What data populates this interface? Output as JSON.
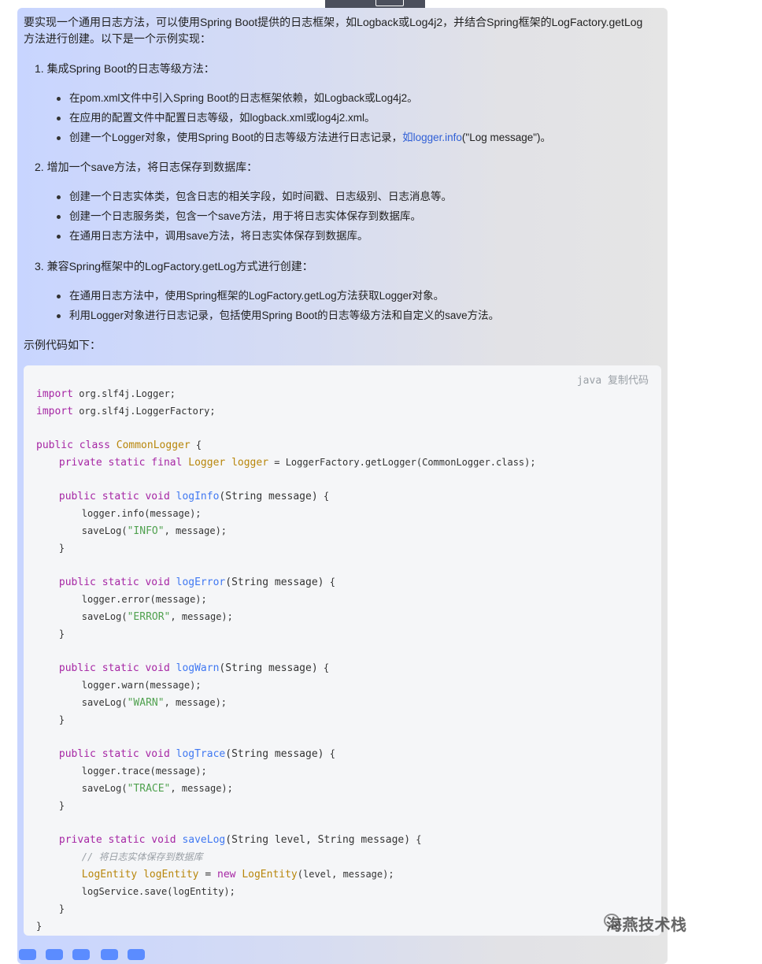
{
  "intro": {
    "line1": "要实现一个通用日志方法，可以使用Spring Boot提供的日志框架，如Logback或Log4j2，并结合Spring框架的LogFactory.getLog",
    "line2": "方法进行创建。以下是一个示例实现："
  },
  "sections": [
    {
      "heading": "1. 集成Spring Boot的日志等级方法：",
      "items": [
        "在pom.xml文件中引入Spring Boot的日志框架依赖，如Logback或Log4j2。",
        "在应用的配置文件中配置日志等级，如logback.xml或log4j2.xml。"
      ],
      "item3_prefix": "创建一个Logger对象，使用Spring Boot的日志等级方法进行日志记录，",
      "item3_link": "如logger.info",
      "item3_suffix": "(\"Log message\")。"
    },
    {
      "heading": "2. 增加一个save方法，将日志保存到数据库：",
      "items": [
        "创建一个日志实体类，包含日志的相关字段，如时间戳、日志级别、日志消息等。",
        "创建一个日志服务类，包含一个save方法，用于将日志实体保存到数据库。",
        "在通用日志方法中，调用save方法，将日志实体保存到数据库。"
      ]
    },
    {
      "heading": "3. 兼容Spring框架中的LogFactory.getLog方式进行创建：",
      "items": [
        "在通用日志方法中，使用Spring框架的LogFactory.getLog方法获取Logger对象。",
        "利用Logger对象进行日志记录，包括使用Spring Boot的日志等级方法和自定义的save方法。"
      ]
    }
  ],
  "code_intro": "示例代码如下：",
  "code_block": {
    "language": "java",
    "copy_label": "复制代码",
    "lines": [
      {
        "indent": "",
        "tokens": [
          [
            "kw",
            "import"
          ],
          [
            "p",
            " org.slf4j.Logger;"
          ]
        ]
      },
      {
        "indent": "",
        "tokens": [
          [
            "kw",
            "import"
          ],
          [
            "p",
            " org.slf4j.LoggerFactory;"
          ]
        ]
      },
      {
        "indent": "",
        "tokens": []
      },
      {
        "indent": "",
        "tokens": [
          [
            "kw",
            "public class "
          ],
          [
            "ty",
            "CommonLogger"
          ],
          [
            "p",
            " {"
          ]
        ]
      },
      {
        "indent": "    ",
        "tokens": [
          [
            "kw",
            "private static final "
          ],
          [
            "ty",
            "Logger logger"
          ],
          [
            "p",
            " = LoggerFactory.getLogger(CommonLogger.class);"
          ]
        ]
      },
      {
        "indent": "",
        "tokens": []
      },
      {
        "indent": "    ",
        "tokens": [
          [
            "kw",
            "public static void "
          ],
          [
            "fn",
            "logInfo"
          ],
          [
            "p13",
            "(String message)"
          ],
          [
            "p",
            " {"
          ]
        ]
      },
      {
        "indent": "        ",
        "tokens": [
          [
            "p",
            "logger.info(message);"
          ]
        ]
      },
      {
        "indent": "        ",
        "tokens": [
          [
            "p",
            "saveLog("
          ],
          [
            "str",
            "\"INFO\""
          ],
          [
            "p",
            ", message);"
          ]
        ]
      },
      {
        "indent": "    ",
        "tokens": [
          [
            "p",
            "}"
          ]
        ]
      },
      {
        "indent": "",
        "tokens": []
      },
      {
        "indent": "    ",
        "tokens": [
          [
            "kw",
            "public static void "
          ],
          [
            "fn",
            "logError"
          ],
          [
            "p13",
            "(String message)"
          ],
          [
            "p",
            " {"
          ]
        ]
      },
      {
        "indent": "        ",
        "tokens": [
          [
            "p",
            "logger.error(message);"
          ]
        ]
      },
      {
        "indent": "        ",
        "tokens": [
          [
            "p",
            "saveLog("
          ],
          [
            "str",
            "\"ERROR\""
          ],
          [
            "p",
            ", message);"
          ]
        ]
      },
      {
        "indent": "    ",
        "tokens": [
          [
            "p",
            "}"
          ]
        ]
      },
      {
        "indent": "",
        "tokens": []
      },
      {
        "indent": "    ",
        "tokens": [
          [
            "kw",
            "public static void "
          ],
          [
            "fn",
            "logWarn"
          ],
          [
            "p13",
            "(String message)"
          ],
          [
            "p",
            " {"
          ]
        ]
      },
      {
        "indent": "        ",
        "tokens": [
          [
            "p",
            "logger.warn(message);"
          ]
        ]
      },
      {
        "indent": "        ",
        "tokens": [
          [
            "p",
            "saveLog("
          ],
          [
            "str",
            "\"WARN\""
          ],
          [
            "p",
            ", message);"
          ]
        ]
      },
      {
        "indent": "    ",
        "tokens": [
          [
            "p",
            "}"
          ]
        ]
      },
      {
        "indent": "",
        "tokens": []
      },
      {
        "indent": "    ",
        "tokens": [
          [
            "kw",
            "public static void "
          ],
          [
            "fn",
            "logTrace"
          ],
          [
            "p13",
            "(String message)"
          ],
          [
            "p",
            " {"
          ]
        ]
      },
      {
        "indent": "        ",
        "tokens": [
          [
            "p",
            "logger.trace(message);"
          ]
        ]
      },
      {
        "indent": "        ",
        "tokens": [
          [
            "p",
            "saveLog("
          ],
          [
            "str",
            "\"TRACE\""
          ],
          [
            "p",
            ", message);"
          ]
        ]
      },
      {
        "indent": "    ",
        "tokens": [
          [
            "p",
            "}"
          ]
        ]
      },
      {
        "indent": "",
        "tokens": []
      },
      {
        "indent": "    ",
        "tokens": [
          [
            "kw",
            "private static void "
          ],
          [
            "fn",
            "saveLog"
          ],
          [
            "p13",
            "(String level, String message)"
          ],
          [
            "p",
            " {"
          ]
        ]
      },
      {
        "indent": "        ",
        "tokens": [
          [
            "com",
            "// 将日志实体保存到数据库"
          ]
        ]
      },
      {
        "indent": "        ",
        "tokens": [
          [
            "ty",
            "LogEntity logEntity"
          ],
          [
            "p13",
            " = "
          ],
          [
            "kw",
            "new "
          ],
          [
            "ty",
            "LogEntity"
          ],
          [
            "p",
            "(level, message);"
          ]
        ]
      },
      {
        "indent": "        ",
        "tokens": [
          [
            "p",
            "logService.save(logEntity);"
          ]
        ]
      },
      {
        "indent": "    ",
        "tokens": [
          [
            "p",
            "}"
          ]
        ]
      },
      {
        "indent": "",
        "tokens": [
          [
            "p",
            "}"
          ]
        ]
      }
    ]
  },
  "watermark": "海燕技术栈",
  "colors": {
    "link": "#2f5fd6",
    "keyword": "#a626a4",
    "type": "#b8860b",
    "function": "#4078f2",
    "string": "#50a14f"
  }
}
